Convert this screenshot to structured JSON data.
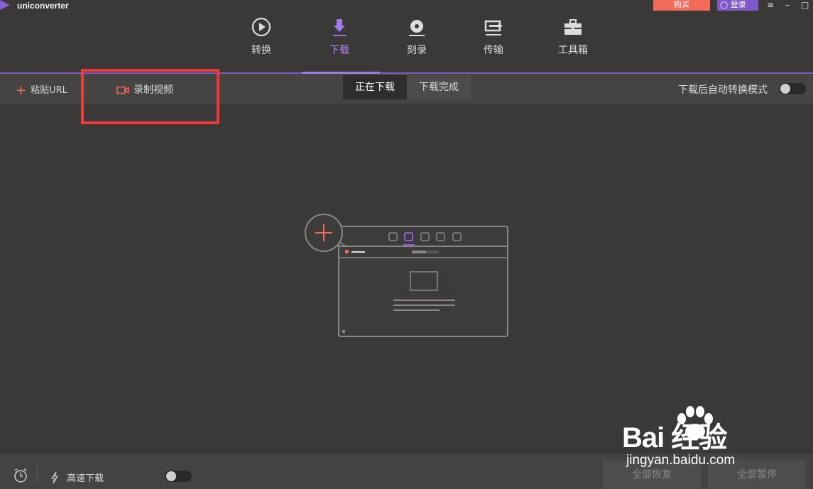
{
  "titlebar": {
    "app_name": "uniconverter",
    "buy_label": "购买",
    "login_label": "登录",
    "menu_icon": "≡",
    "minimize_icon": "–",
    "maximize_icon": "□"
  },
  "nav": {
    "items": [
      {
        "label": "转换",
        "icon": "convert-icon"
      },
      {
        "label": "下载",
        "icon": "download-icon",
        "active": true
      },
      {
        "label": "刻录",
        "icon": "burn-icon"
      },
      {
        "label": "传输",
        "icon": "transfer-icon"
      },
      {
        "label": "工具箱",
        "icon": "toolbox-icon"
      }
    ]
  },
  "toolbar": {
    "paste_url": "粘贴URL",
    "record_video": "录制视频",
    "tabs": [
      "正在下载",
      "下载完成"
    ],
    "auto_convert_label": "下载后自动转换模式",
    "auto_convert_on": false
  },
  "bottombar": {
    "high_speed_label": "高速下载",
    "high_speed_on": false,
    "resume_all": "全部恢复",
    "pause_all": "全部暂停"
  },
  "watermark": {
    "brand": "Bai 经验",
    "url": "jingyan.baidu.com"
  },
  "colors": {
    "accent_purple": "#7f58c9",
    "accent_orange": "#f26b59",
    "highlight_red": "#f03a3a"
  }
}
